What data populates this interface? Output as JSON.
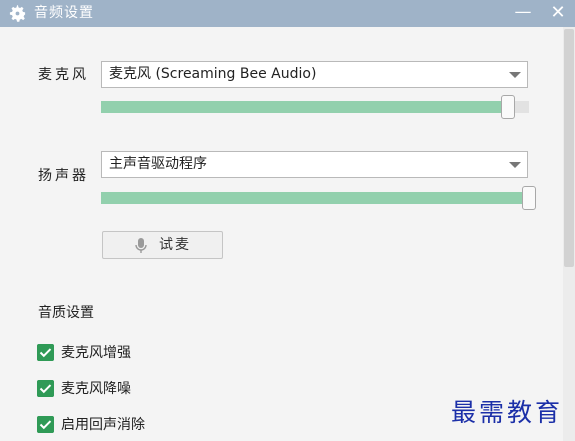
{
  "window": {
    "title": "音频设置",
    "title_icon": "gear-icon",
    "minimize_label": "—",
    "close_label": "✕",
    "title_bar_color": "#9fb3c8"
  },
  "microphone": {
    "label": "麦克风",
    "device": "麦克风 (Screaming Bee Audio)",
    "volume_fraction": 0.95
  },
  "speaker": {
    "label": "扬声器",
    "device": "主声音驱动程序",
    "volume_fraction": 1.0
  },
  "test_button": {
    "label": "试麦",
    "icon": "microphone-icon"
  },
  "quality": {
    "title": "音质设置",
    "options": [
      {
        "label": "麦克风增强",
        "checked": true
      },
      {
        "label": "麦克风降噪",
        "checked": true
      },
      {
        "label": "启用回声消除",
        "checked": true
      }
    ]
  },
  "colors": {
    "accent_fill": "#92d0ad",
    "checkbox": "#2f9a56"
  },
  "watermark": "最需教育"
}
